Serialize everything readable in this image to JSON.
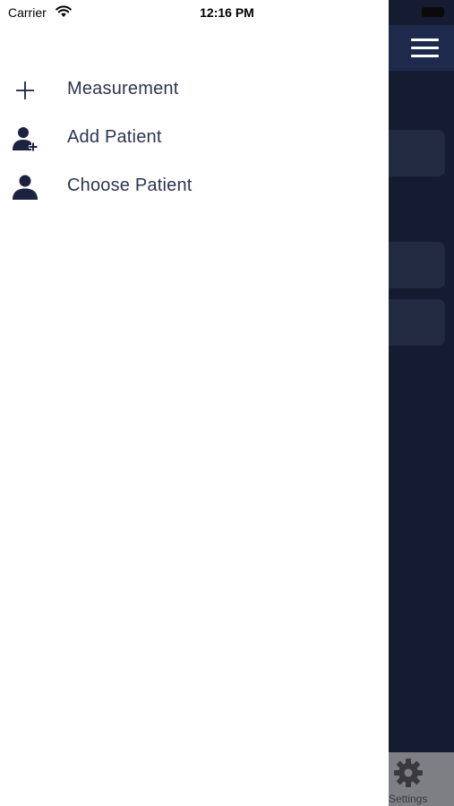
{
  "status_bar": {
    "carrier": "Carrier",
    "time": "12:16 PM"
  },
  "drawer": {
    "items": [
      {
        "label": "Measurement",
        "icon": "plus-icon"
      },
      {
        "label": "Add Patient",
        "icon": "add-user-icon"
      },
      {
        "label": "Choose Patient",
        "icon": "user-icon"
      }
    ]
  },
  "tab_bar": {
    "settings_label": "Settings",
    "settings_icon": "gear-icon"
  },
  "colors": {
    "drawer_bg": "#ffffff",
    "app_bg": "#151b30",
    "navbar_bg": "#1e2a4c",
    "text": "#2c3552",
    "icon": "#1b2340",
    "tabbar_bg": "#7d7f85"
  }
}
